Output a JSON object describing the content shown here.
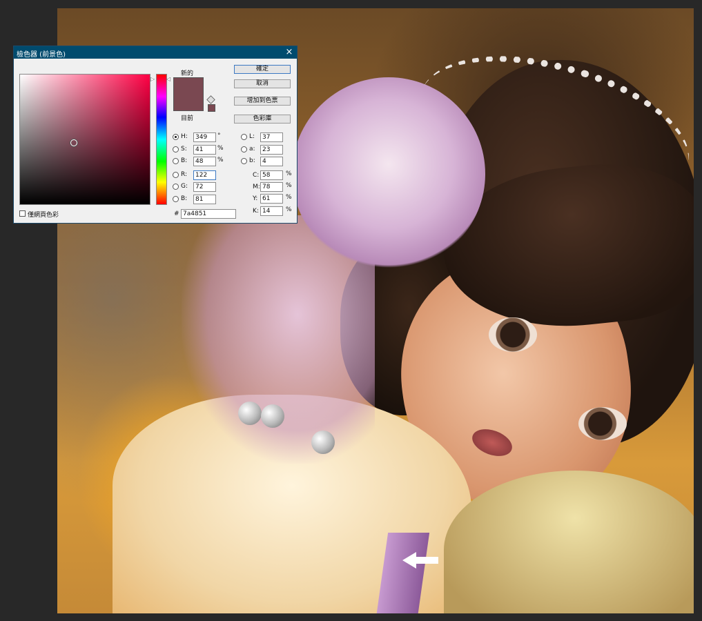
{
  "dialog": {
    "title": "檢色器 (前景色)",
    "close_icon": "×",
    "label_new": "新的",
    "label_current": "目前",
    "new_color": "#7a4851",
    "current_color": "#7a4851",
    "buttons": {
      "ok": "確定",
      "cancel": "取消",
      "add_to_swatches": "增加到色票",
      "color_libraries": "色彩庫"
    },
    "hsb": {
      "h_label": "H:",
      "h_value": "349",
      "h_unit": "°",
      "s_label": "S:",
      "s_value": "41",
      "s_unit": "%",
      "b_label": "B:",
      "b_value": "48",
      "b_unit": "%"
    },
    "rgb": {
      "r_label": "R:",
      "r_value": "122",
      "g_label": "G:",
      "g_value": "72",
      "b_label": "B:",
      "b_value": "81"
    },
    "lab": {
      "l_label": "L:",
      "l_value": "37",
      "a_label": "a:",
      "a_value": "23",
      "b_label": "b:",
      "b_value": "4"
    },
    "cmyk": {
      "c_label": "C:",
      "c_value": "58",
      "c_unit": "%",
      "m_label": "M:",
      "m_value": "78",
      "m_unit": "%",
      "y_label": "Y:",
      "y_value": "61",
      "y_unit": "%",
      "k_label": "K:",
      "k_value": "14",
      "k_unit": "%"
    },
    "hex_label": "#",
    "hex_value": "7a4851",
    "web_colors_label": "僅網頁色彩",
    "selected_mode": "H"
  },
  "colors": {
    "titlebar": "#004b6e",
    "hue_field": "#ff0044",
    "arrow": "#ffffff"
  },
  "icons": {
    "close": "close-icon",
    "out_of_gamut": "cube-icon",
    "arrow": "arrow-left-icon"
  }
}
